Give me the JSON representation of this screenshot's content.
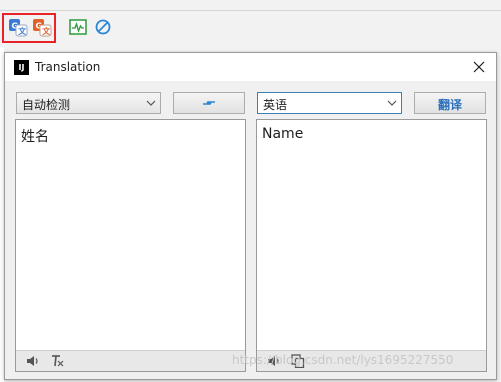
{
  "toolbar": {
    "icons": [
      "translate-icon",
      "translate-replace-icon",
      "activity-monitor-icon",
      "disable-icon"
    ]
  },
  "dialog": {
    "logo_text": "IJ",
    "title": "Translation",
    "source_language": "自动检测",
    "target_language": "英语",
    "translate_button": "翻译",
    "source_text": "姓名",
    "result_text": "Name"
  },
  "watermark": "https://blog.csdn.net/lys1695227550",
  "colors": {
    "highlight_border": "#e8242a",
    "accent_blue": "#2a6fbd",
    "focus_border": "#3c7fb1"
  }
}
